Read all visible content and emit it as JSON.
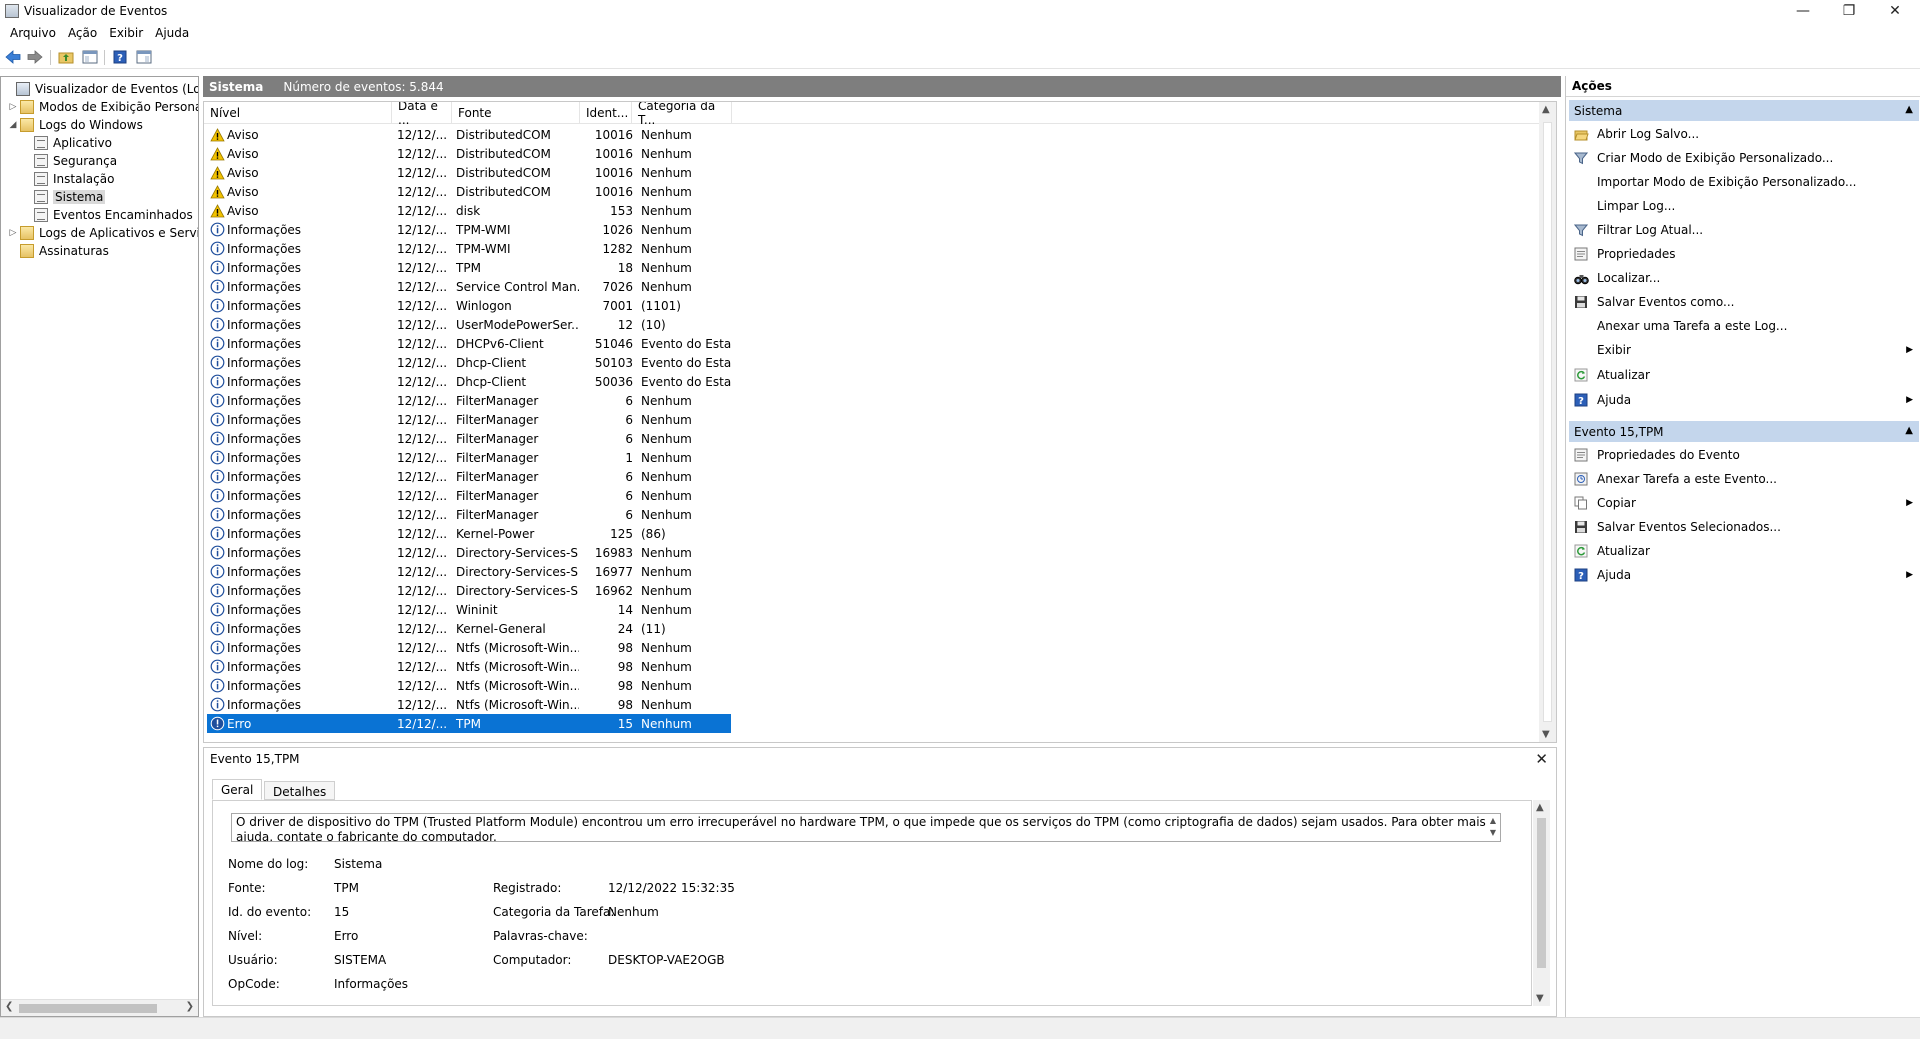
{
  "window": {
    "title": "Visualizador de Eventos",
    "min": "—",
    "max": "❐",
    "close": "✕"
  },
  "menu": [
    "Arquivo",
    "Ação",
    "Exibir",
    "Ajuda"
  ],
  "tree": {
    "root": "Visualizador de Eventos (Local)",
    "custom_views": "Modos de Exibição Personali",
    "windows_logs": "Logs do Windows",
    "logs": [
      "Aplicativo",
      "Segurança",
      "Instalação",
      "Sistema",
      "Eventos Encaminhados"
    ],
    "app_services": "Logs de Aplicativos e Serviço",
    "subscriptions": "Assinaturas"
  },
  "center": {
    "log_name": "Sistema",
    "event_count": "Número de eventos: 5.844"
  },
  "columns": [
    "Nível",
    "Data e ...",
    "Fonte",
    "Ident...",
    "Categoria da T..."
  ],
  "events": [
    {
      "level": "Aviso",
      "type": "warning",
      "date": "12/12/...",
      "source": "DistributedCOM",
      "id": "10016",
      "category": "Nenhum"
    },
    {
      "level": "Aviso",
      "type": "warning",
      "date": "12/12/...",
      "source": "DistributedCOM",
      "id": "10016",
      "category": "Nenhum"
    },
    {
      "level": "Aviso",
      "type": "warning",
      "date": "12/12/...",
      "source": "DistributedCOM",
      "id": "10016",
      "category": "Nenhum"
    },
    {
      "level": "Aviso",
      "type": "warning",
      "date": "12/12/...",
      "source": "DistributedCOM",
      "id": "10016",
      "category": "Nenhum"
    },
    {
      "level": "Aviso",
      "type": "warning",
      "date": "12/12/...",
      "source": "disk",
      "id": "153",
      "category": "Nenhum"
    },
    {
      "level": "Informações",
      "type": "info",
      "date": "12/12/...",
      "source": "TPM-WMI",
      "id": "1026",
      "category": "Nenhum"
    },
    {
      "level": "Informações",
      "type": "info",
      "date": "12/12/...",
      "source": "TPM-WMI",
      "id": "1282",
      "category": "Nenhum"
    },
    {
      "level": "Informações",
      "type": "info",
      "date": "12/12/...",
      "source": "TPM",
      "id": "18",
      "category": "Nenhum"
    },
    {
      "level": "Informações",
      "type": "info",
      "date": "12/12/...",
      "source": "Service Control Man...",
      "id": "7026",
      "category": "Nenhum"
    },
    {
      "level": "Informações",
      "type": "info",
      "date": "12/12/...",
      "source": "Winlogon",
      "id": "7001",
      "category": "(1101)"
    },
    {
      "level": "Informações",
      "type": "info",
      "date": "12/12/...",
      "source": "UserModePowerSer...",
      "id": "12",
      "category": "(10)"
    },
    {
      "level": "Informações",
      "type": "info",
      "date": "12/12/...",
      "source": "DHCPv6-Client",
      "id": "51046",
      "category": "Evento do Esta..."
    },
    {
      "level": "Informações",
      "type": "info",
      "date": "12/12/...",
      "source": "Dhcp-Client",
      "id": "50103",
      "category": "Evento do Esta..."
    },
    {
      "level": "Informações",
      "type": "info",
      "date": "12/12/...",
      "source": "Dhcp-Client",
      "id": "50036",
      "category": "Evento do Esta..."
    },
    {
      "level": "Informações",
      "type": "info",
      "date": "12/12/...",
      "source": "FilterManager",
      "id": "6",
      "category": "Nenhum"
    },
    {
      "level": "Informações",
      "type": "info",
      "date": "12/12/...",
      "source": "FilterManager",
      "id": "6",
      "category": "Nenhum"
    },
    {
      "level": "Informações",
      "type": "info",
      "date": "12/12/...",
      "source": "FilterManager",
      "id": "6",
      "category": "Nenhum"
    },
    {
      "level": "Informações",
      "type": "info",
      "date": "12/12/...",
      "source": "FilterManager",
      "id": "1",
      "category": "Nenhum"
    },
    {
      "level": "Informações",
      "type": "info",
      "date": "12/12/...",
      "source": "FilterManager",
      "id": "6",
      "category": "Nenhum"
    },
    {
      "level": "Informações",
      "type": "info",
      "date": "12/12/...",
      "source": "FilterManager",
      "id": "6",
      "category": "Nenhum"
    },
    {
      "level": "Informações",
      "type": "info",
      "date": "12/12/...",
      "source": "FilterManager",
      "id": "6",
      "category": "Nenhum"
    },
    {
      "level": "Informações",
      "type": "info",
      "date": "12/12/...",
      "source": "Kernel-Power",
      "id": "125",
      "category": "(86)"
    },
    {
      "level": "Informações",
      "type": "info",
      "date": "12/12/...",
      "source": "Directory-Services-S...",
      "id": "16983",
      "category": "Nenhum"
    },
    {
      "level": "Informações",
      "type": "info",
      "date": "12/12/...",
      "source": "Directory-Services-S...",
      "id": "16977",
      "category": "Nenhum"
    },
    {
      "level": "Informações",
      "type": "info",
      "date": "12/12/...",
      "source": "Directory-Services-S...",
      "id": "16962",
      "category": "Nenhum"
    },
    {
      "level": "Informações",
      "type": "info",
      "date": "12/12/...",
      "source": "Wininit",
      "id": "14",
      "category": "Nenhum"
    },
    {
      "level": "Informações",
      "type": "info",
      "date": "12/12/...",
      "source": "Kernel-General",
      "id": "24",
      "category": "(11)"
    },
    {
      "level": "Informações",
      "type": "info",
      "date": "12/12/...",
      "source": "Ntfs (Microsoft-Win...",
      "id": "98",
      "category": "Nenhum"
    },
    {
      "level": "Informações",
      "type": "info",
      "date": "12/12/...",
      "source": "Ntfs (Microsoft-Win...",
      "id": "98",
      "category": "Nenhum"
    },
    {
      "level": "Informações",
      "type": "info",
      "date": "12/12/...",
      "source": "Ntfs (Microsoft-Win...",
      "id": "98",
      "category": "Nenhum"
    },
    {
      "level": "Informações",
      "type": "info",
      "date": "12/12/...",
      "source": "Ntfs (Microsoft-Win...",
      "id": "98",
      "category": "Nenhum"
    },
    {
      "level": "Erro",
      "type": "error",
      "date": "12/12/...",
      "source": "TPM",
      "id": "15",
      "category": "Nenhum",
      "selected": true
    }
  ],
  "detail": {
    "title": "Evento 15,TPM",
    "tabs": [
      "Geral",
      "Detalhes"
    ],
    "description": "O driver de dispositivo do TPM (Trusted Platform Module) encontrou um erro irrecuperável no hardware TPM, o que impede que os serviços do TPM (como criptografia de dados) sejam usados. Para obter mais ajuda, contate o fabricante do computador.",
    "labels": {
      "log_name": "Nome do log:",
      "source": "Fonte:",
      "event_id": "Id. do evento:",
      "level": "Nível:",
      "user": "Usuário:",
      "opcode": "OpCode:",
      "logged": "Registrado:",
      "task_category": "Categoria da Tarefa:",
      "keywords": "Palavras-chave:",
      "computer": "Computador:"
    },
    "values": {
      "log_name": "Sistema",
      "source": "TPM",
      "event_id": "15",
      "level": "Erro",
      "user": "SISTEMA",
      "opcode": "Informações",
      "logged": "12/12/2022 15:32:35",
      "task_category": "Nenhum",
      "keywords": "",
      "computer": "DESKTOP-VAE2OGB"
    }
  },
  "actions": {
    "title": "Ações",
    "section1": "Sistema",
    "items1": [
      {
        "label": "Abrir Log Salvo...",
        "icon": "folder-open-icon"
      },
      {
        "label": "Criar Modo de Exibição Personalizado...",
        "icon": "filter-icon"
      },
      {
        "label": "Importar Modo de Exibição Personalizado...",
        "icon": ""
      },
      {
        "label": "Limpar Log...",
        "icon": ""
      },
      {
        "label": "Filtrar Log Atual...",
        "icon": "filter-icon"
      },
      {
        "label": "Propriedades",
        "icon": "properties-icon"
      },
      {
        "label": "Localizar...",
        "icon": "binoculars-icon"
      },
      {
        "label": "Salvar Eventos como...",
        "icon": "save-icon"
      },
      {
        "label": "Anexar uma Tarefa a este Log...",
        "icon": ""
      },
      {
        "label": "Exibir",
        "icon": "",
        "submenu": true
      },
      {
        "label": "Atualizar",
        "icon": "refresh-icon"
      },
      {
        "label": "Ajuda",
        "icon": "help-icon",
        "submenu": true
      }
    ],
    "section2": "Evento 15,TPM",
    "items2": [
      {
        "label": "Propriedades do Evento",
        "icon": "properties-icon"
      },
      {
        "label": "Anexar Tarefa a este Evento...",
        "icon": "task-icon"
      },
      {
        "label": "Copiar",
        "icon": "copy-icon",
        "submenu": true
      },
      {
        "label": "Salvar Eventos Selecionados...",
        "icon": "save-icon"
      },
      {
        "label": "Atualizar",
        "icon": "refresh-icon"
      },
      {
        "label": "Ajuda",
        "icon": "help-icon",
        "submenu": true
      }
    ]
  },
  "colors": {
    "selection": "#0a73d4",
    "section_header": "#c4d6ec",
    "center_header": "#7e7e7e",
    "warning": "#f2c200",
    "info": "#1f4e9c",
    "error": "#1f4e9c"
  }
}
